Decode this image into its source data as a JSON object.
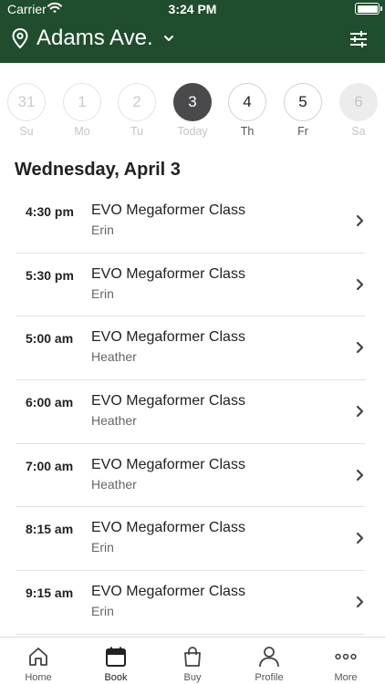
{
  "status_bar": {
    "carrier": "Carrier",
    "time": "3:24 PM"
  },
  "header": {
    "location": "Adams Ave.",
    "background": "#1f4d2d"
  },
  "days": [
    {
      "num": "31",
      "label": "Su",
      "state": "past"
    },
    {
      "num": "1",
      "label": "Mo",
      "state": "past"
    },
    {
      "num": "2",
      "label": "Tu",
      "state": "past"
    },
    {
      "num": "3",
      "label": "Today",
      "state": "today"
    },
    {
      "num": "4",
      "label": "Th",
      "state": "upcoming"
    },
    {
      "num": "5",
      "label": "Fr",
      "state": "upcoming"
    },
    {
      "num": "6",
      "label": "Sa",
      "state": "disabled"
    }
  ],
  "date_heading": "Wednesday, April 3",
  "classes": [
    {
      "time": "4:30 pm",
      "name": "EVO Megaformer Class",
      "instructor": "Erin"
    },
    {
      "time": "5:30 pm",
      "name": "EVO Megaformer Class",
      "instructor": "Erin"
    },
    {
      "time": "5:00 am",
      "name": "EVO Megaformer Class",
      "instructor": "Heather"
    },
    {
      "time": "6:00 am",
      "name": "EVO Megaformer Class",
      "instructor": "Heather"
    },
    {
      "time": "7:00 am",
      "name": "EVO Megaformer Class",
      "instructor": "Heather"
    },
    {
      "time": "8:15 am",
      "name": "EVO Megaformer Class",
      "instructor": "Erin"
    },
    {
      "time": "9:15 am",
      "name": "EVO Megaformer Class",
      "instructor": "Erin"
    }
  ],
  "tabs": [
    {
      "label": "Home",
      "icon": "home-icon"
    },
    {
      "label": "Book",
      "icon": "calendar-icon"
    },
    {
      "label": "Buy",
      "icon": "shopping-bag-icon"
    },
    {
      "label": "Profile",
      "icon": "profile-icon"
    },
    {
      "label": "More",
      "icon": "more-icon"
    }
  ]
}
